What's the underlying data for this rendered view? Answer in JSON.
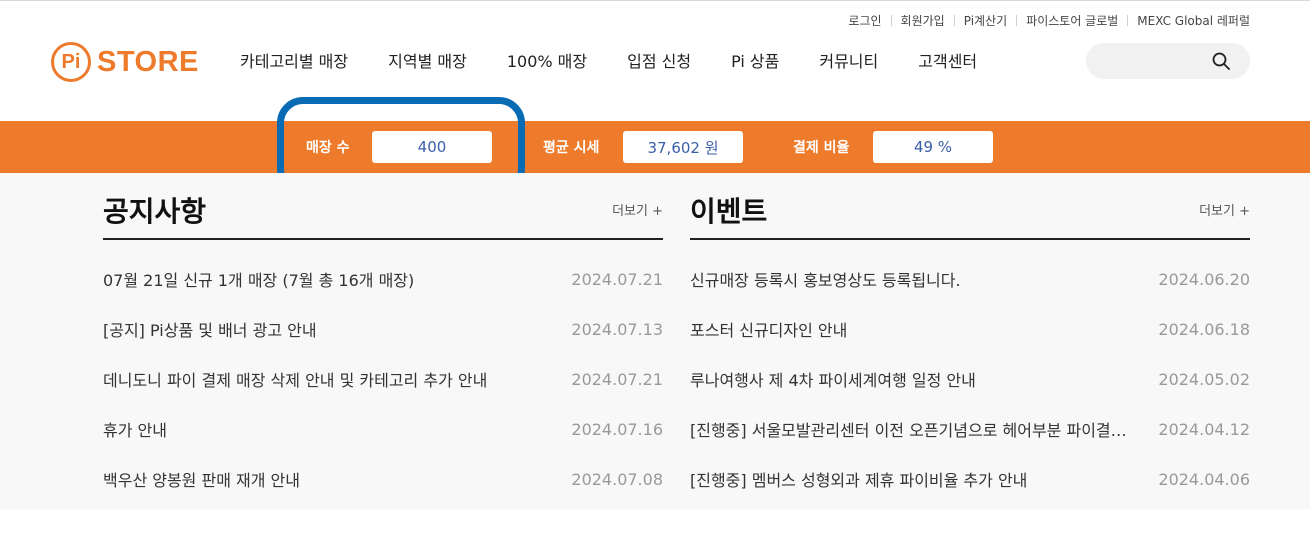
{
  "util_links": [
    "로그인",
    "회원가입",
    "Pi계산기",
    "파이스토어 글로벌",
    "MEXC Global 레퍼럴"
  ],
  "logo": {
    "mark": "Pi",
    "text": "STORE"
  },
  "nav": [
    "카테고리별 매장",
    "지역별 매장",
    "100% 매장",
    "입점 신청",
    "Pi 상품",
    "커뮤니티",
    "고객센터"
  ],
  "search": {
    "placeholder": "",
    "icon": "search-icon"
  },
  "stats": [
    {
      "label": "매장 수",
      "value": "400"
    },
    {
      "label": "평균 시세",
      "value": "37,602 원"
    },
    {
      "label": "결제 비율",
      "value": "49 %"
    }
  ],
  "notice": {
    "title": "공지사항",
    "more": "더보기 +",
    "items": [
      {
        "title": "07월 21일 신규 1개 매장 (7월 총 16개 매장)",
        "date": "2024.07.21"
      },
      {
        "title": "[공지] Pi상품 및 배너 광고 안내",
        "date": "2024.07.13"
      },
      {
        "title": "데니도니 파이 결제 매장 삭제 안내 및 카테고리 추가 안내",
        "date": "2024.07.21"
      },
      {
        "title": "휴가 안내",
        "date": "2024.07.16"
      },
      {
        "title": "백우산 양봉원 판매 재개 안내",
        "date": "2024.07.08"
      }
    ]
  },
  "event": {
    "title": "이벤트",
    "more": "더보기 +",
    "items": [
      {
        "title": "신규매장 등록시 홍보영상도 등록됩니다.",
        "date": "2024.06.20"
      },
      {
        "title": "포스터 신규디자인 안내",
        "date": "2024.06.18"
      },
      {
        "title": "루나여행사 제 4차 파이세계여행 일정 안내",
        "date": "2024.05.02"
      },
      {
        "title": "[진행중] 서울모발관리센터 이전 오픈기념으로 헤어부분 파이결제 할인 이벤트",
        "date": "2024.04.12"
      },
      {
        "title": "[진행중] 멤버스 성형외과 제휴 파이비율 추가 안내",
        "date": "2024.04.06"
      }
    ]
  },
  "colors": {
    "brand": "#ee7b2c",
    "highlight": "#0a6bb5",
    "stat_value": "#3a5ea8"
  }
}
